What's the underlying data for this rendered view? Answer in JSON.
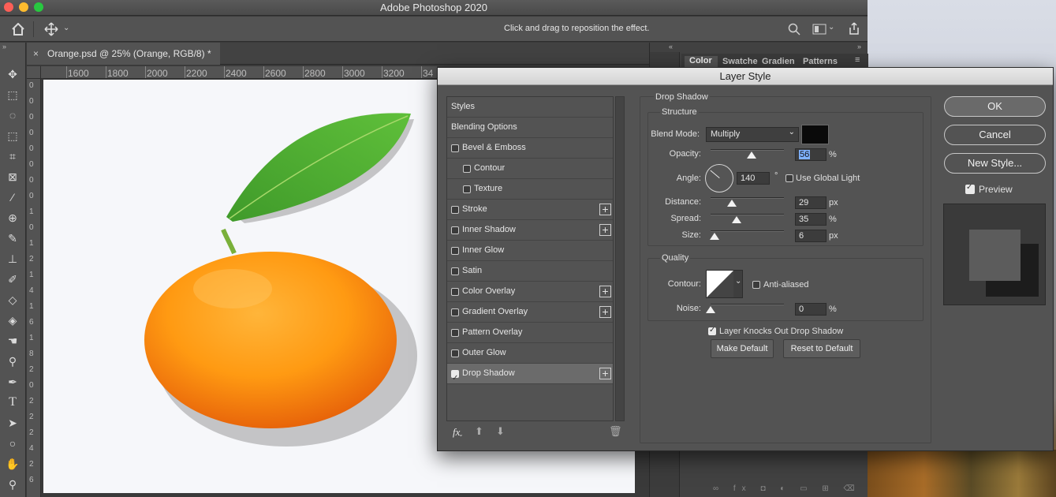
{
  "window": {
    "title": "Adobe Photoshop 2020"
  },
  "options_bar": {
    "hint": "Click and drag to reposition the effect."
  },
  "document": {
    "tab_title": "Orange.psd @ 25% (Orange, RGB/8) *",
    "close_glyph": "×"
  },
  "ruler": {
    "h_ticks": [
      "1600",
      "1800",
      "2000",
      "2200",
      "2400",
      "2600",
      "2800",
      "3000",
      "3200",
      "34"
    ],
    "v_ticks": [
      "0",
      "0",
      "0",
      "0",
      "0",
      "0",
      "0",
      "0",
      "1",
      "0",
      "1",
      "2",
      "1",
      "4",
      "1",
      "6",
      "1",
      "8",
      "2",
      "0",
      "2",
      "2",
      "2",
      "4",
      "2",
      "6"
    ]
  },
  "right_panel": {
    "tabs": [
      "Color",
      "Swatche",
      "Gradien",
      "Patterns"
    ]
  },
  "dialog": {
    "title": "Layer Style",
    "styles_header": "Styles",
    "blending_options": "Blending Options",
    "style_items": [
      {
        "label": "Bevel & Emboss",
        "checked": false,
        "has_plus": false
      },
      {
        "label": "Contour",
        "checked": false,
        "has_plus": false
      },
      {
        "label": "Texture",
        "checked": false,
        "has_plus": false
      },
      {
        "label": "Stroke",
        "checked": false,
        "has_plus": true
      },
      {
        "label": "Inner Shadow",
        "checked": false,
        "has_plus": true
      },
      {
        "label": "Inner Glow",
        "checked": false,
        "has_plus": false
      },
      {
        "label": "Satin",
        "checked": false,
        "has_plus": false
      },
      {
        "label": "Color Overlay",
        "checked": false,
        "has_plus": true
      },
      {
        "label": "Gradient Overlay",
        "checked": false,
        "has_plus": true
      },
      {
        "label": "Pattern Overlay",
        "checked": false,
        "has_plus": false
      },
      {
        "label": "Outer Glow",
        "checked": false,
        "has_plus": false
      },
      {
        "label": "Drop Shadow",
        "checked": true,
        "has_plus": true
      }
    ],
    "fx_label": "fx",
    "section_title": "Drop Shadow",
    "structure": {
      "title": "Structure",
      "blend_mode_label": "Blend Mode:",
      "blend_mode_value": "Multiply",
      "shadow_color": "#0a0a0a",
      "opacity_label": "Opacity:",
      "opacity_value": "56",
      "opacity_unit": "%",
      "angle_label": "Angle:",
      "angle_value": "140",
      "angle_unit": "°",
      "use_global_light": "Use Global Light",
      "use_global_light_checked": false,
      "distance_label": "Distance:",
      "distance_value": "29",
      "distance_unit": "px",
      "spread_label": "Spread:",
      "spread_value": "35",
      "spread_unit": "%",
      "size_label": "Size:",
      "size_value": "6",
      "size_unit": "px"
    },
    "quality": {
      "title": "Quality",
      "contour_label": "Contour:",
      "anti_aliased": "Anti-aliased",
      "anti_aliased_checked": false,
      "noise_label": "Noise:",
      "noise_value": "0",
      "noise_unit": "%"
    },
    "knockout_label": "Layer Knocks Out Drop Shadow",
    "knockout_checked": true,
    "make_default": "Make Default",
    "reset_default": "Reset to Default",
    "ok": "OK",
    "cancel": "Cancel",
    "new_style": "New Style...",
    "preview_label": "Preview",
    "preview_checked": true
  }
}
